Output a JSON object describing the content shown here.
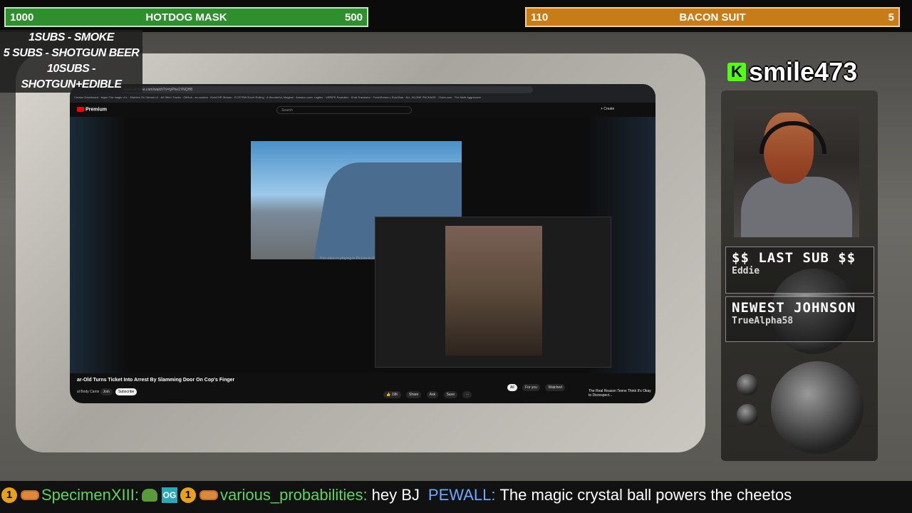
{
  "goals": {
    "left": {
      "current": "1000",
      "name": "HOTDOG MASK",
      "target": "500",
      "color": "#2f8f2f"
    },
    "right": {
      "current": "110",
      "name": "BACON SUIT",
      "target": "5",
      "color": "#c77c18"
    }
  },
  "sub_rewards": [
    "1SUBS   - SMOKE",
    "5 SUBS  - SHOTGUN BEER",
    "10SUBS - SHOTGUN+EDIBLE"
  ],
  "browser": {
    "url": "www.youtube.com/watch?v=tyPhe1YNQH8",
    "bookmarks": "Creator Dashboard · tegan The magic of L · Marbles On Stream Ul · All Other Tracks · GitHub - ac-custom · KickCHR Stream · ECSTRW Excel Rolling · A Wonderful, Magical · Amazon.com: Logitec · VERIFE Repeater · Chat Translator · FreshScreen | Rust Bas · ALL-IN-ONE PACKAGE · Clubs.com · The Multi Aggressive",
    "logo": "Premium",
    "search_placeholder": "Search",
    "create_label": "+ Create",
    "video_caption": "This video is playing in Picture-in-P",
    "video_title": "ar-Old Turns Ticket Into Arrest By Slamming Door On Cop's Finger",
    "channel": "al Body Cams",
    "join": "Join",
    "subscribe": "Subscribe",
    "likes": "19K",
    "share": "Share",
    "ask": "Ask",
    "save": "Save",
    "more": "···",
    "rec_tabs": [
      "All",
      "For you",
      "Watched"
    ],
    "rec_title": "The Real Reason Teens Think It's Okay to Disrespect..."
  },
  "streamer": {
    "platform_icon": "K",
    "username": "smile473"
  },
  "last_sub": {
    "title": "$$ LAST SUB $$",
    "name": "Eddie"
  },
  "newest": {
    "title": "NEWEST JOHNSON",
    "name": "TrueAlpha58"
  },
  "chat": [
    {
      "user": "SpecimenXIII:",
      "message": "",
      "user_color": "#5fd35f"
    },
    {
      "user": "various_probabilities:",
      "message": "hey BJ",
      "user_color": "#5fd35f"
    },
    {
      "user": "PEWALL:",
      "message": "The magic crystal ball powers the cheetos",
      "user_color": "#6fa8ff"
    }
  ]
}
